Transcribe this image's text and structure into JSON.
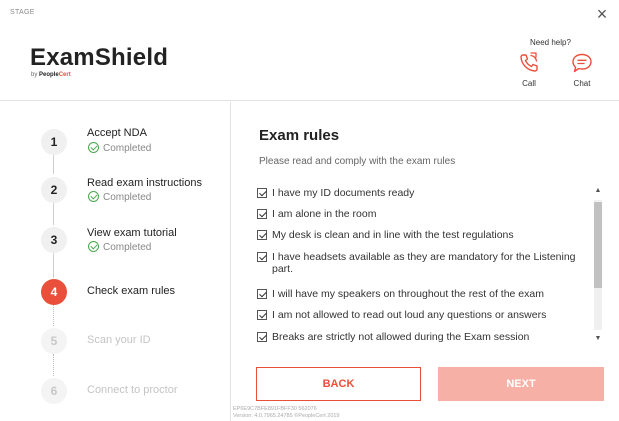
{
  "window": {
    "stage_label": "STAGE",
    "close_glyph": "×"
  },
  "brand": {
    "name": "ExamShield",
    "by": "by ",
    "company_a": "People",
    "company_b": "Cert"
  },
  "help": {
    "title": "Need help?",
    "call_label": "Call",
    "chat_label": "Chat",
    "call_icon": "phone-call-icon",
    "chat_icon": "chat-bubble-icon"
  },
  "colors": {
    "accent": "#e94f3b",
    "accent_light": "#f6b0a5",
    "completed": "#4aa84e"
  },
  "steps": [
    {
      "number": "1",
      "title": "Accept NDA",
      "status": "Completed",
      "state": "done"
    },
    {
      "number": "2",
      "title": "Read exam instructions",
      "status": "Completed",
      "state": "done"
    },
    {
      "number": "3",
      "title": "View exam tutorial",
      "status": "Completed",
      "state": "done"
    },
    {
      "number": "4",
      "title": "Check exam rules",
      "status": "",
      "state": "active"
    },
    {
      "number": "5",
      "title": "Scan your ID",
      "status": "",
      "state": "pending"
    },
    {
      "number": "6",
      "title": "Connect to proctor",
      "status": "",
      "state": "pending"
    }
  ],
  "main": {
    "title": "Exam rules",
    "subtitle": "Please read and comply with the exam rules",
    "rules": [
      {
        "text": "I have my ID documents ready",
        "checked": true
      },
      {
        "text": "I am alone in the room",
        "checked": true
      },
      {
        "text": "My desk is clean and in line with the test regulations",
        "checked": true
      },
      {
        "text": "I have headsets available as they are mandatory for the Listening part.",
        "checked": true
      },
      {
        "text": "I will have my speakers on throughout the rest of the exam",
        "checked": true
      },
      {
        "text": "I am not allowed to read out loud any questions or answers",
        "checked": true
      },
      {
        "text": "Breaks are strictly not allowed during the Exam session",
        "checked": true
      }
    ],
    "back_label": "BACK",
    "next_label": "NEXT"
  },
  "footer": {
    "line1": "EP6E9C7BFE891FBFF30 562076",
    "line2": "Version: 4.0.7965.24785 ©PeopleCert 2019"
  }
}
